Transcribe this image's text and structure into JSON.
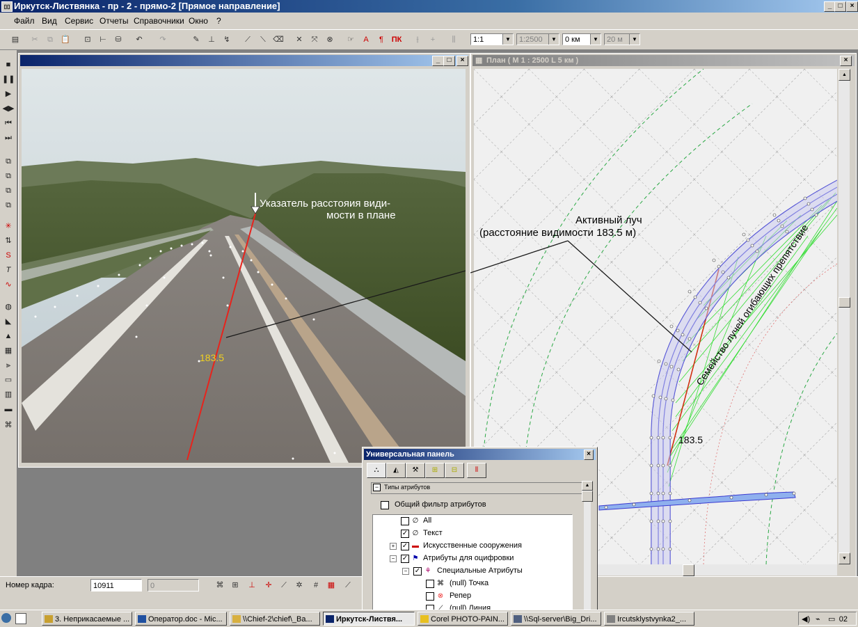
{
  "window": {
    "title": "Иркутск-Листвянка - пр - 2 - прямо-2  [Прямое направление]",
    "minimize_glyph": "_",
    "maximize_glyph": "□",
    "close_glyph": "×"
  },
  "menu": [
    "Файл",
    "Вид",
    "Сервис",
    "Отчеты",
    "Справочники",
    "Окно",
    "?"
  ],
  "toolbar": {
    "scale": "1:1",
    "scale2": "1:2500",
    "offset": "0 км",
    "step": "20 м"
  },
  "video": {
    "pointer_label_line1": "Указатель расстояия види-",
    "pointer_label_line2": "мости в плане",
    "active_ray_line1": "Активный луч",
    "active_ray_line2": "(расстояние видимости 183.5 м)",
    "distance_value": "183.5"
  },
  "plan": {
    "title": "План ( М 1 : 2500  L 5 км )",
    "ray_family_label": "Семейство лучей огибающих препятствие",
    "distance_value": "183.5"
  },
  "status": {
    "frame_label": "Номер кадра:",
    "frame_value": "10911",
    "frame_value2": "0"
  },
  "panel": {
    "title": "Универсальная панель",
    "group_header": "Типы атрибутов",
    "filter_label": "Общий фильтр атрибутов",
    "tree": [
      {
        "label": "All",
        "checked": false,
        "level": 1
      },
      {
        "label": "Текст",
        "checked": true,
        "level": 1
      },
      {
        "label": "Искусственные сооружения",
        "checked": true,
        "level": 1
      },
      {
        "label": "Атрибуты для оцифровки",
        "checked": true,
        "level": 1
      },
      {
        "label": "Специальные Атрибуты",
        "checked": true,
        "level": 2
      },
      {
        "label": "(null) Точка",
        "checked": false,
        "level": 3
      },
      {
        "label": "Репер",
        "checked": false,
        "level": 3
      },
      {
        "label": "(null) Линия",
        "checked": false,
        "level": 3
      }
    ]
  },
  "taskbar": {
    "tasks": [
      "3. Неприкасаемые ...",
      "Оператор.doc - Mic...",
      "\\\\Chief-2\\chief\\_Ba...",
      "Иркутск-Листвя...",
      "Corel PHOTO-PAIN...",
      "\\\\Sql-server\\Big_Dri...",
      "Ircutsklystvynka2_..."
    ],
    "clock": "02"
  },
  "colors": {
    "title_active": "#0a246a",
    "ray_active": "#e8231c",
    "ray_family": "#22cc22",
    "road_outline": "#3a3ad0"
  }
}
